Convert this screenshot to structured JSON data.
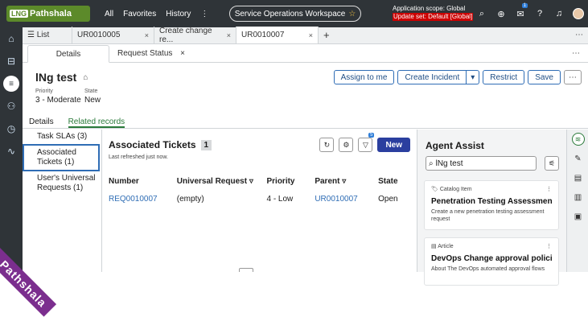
{
  "topbar": {
    "logo_abbr": "LNG",
    "logo_text": "Pathshala",
    "nav": [
      "All",
      "Favorites",
      "History",
      "⋮"
    ],
    "workspace": "Service Operations Workspace",
    "scope_line1": "Application scope: Global",
    "scope_line2": "Update set: Default [Global]",
    "chat_badge": "1"
  },
  "tabs": [
    {
      "label": "☰ List"
    },
    {
      "label": "UR0010005",
      "close": "×"
    },
    {
      "label": "Create change re...",
      "close": "×"
    },
    {
      "label": "UR0010007",
      "close": "×"
    }
  ],
  "subtabs": [
    {
      "label": "Details"
    },
    {
      "label": "Request Status",
      "close": "×"
    }
  ],
  "record": {
    "title": "lNg test",
    "priority_label": "Priority",
    "priority_value": "3 - Moderate",
    "state_label": "State",
    "state_value": "New",
    "buttons": [
      "Assign to me",
      "Create Incident",
      "Restrict",
      "Save"
    ]
  },
  "record_tabs": [
    "Details",
    "Related records"
  ],
  "related_nav": [
    "Task SLAs (3)",
    "Associated Tickets (1)",
    "User's Universal Requests (1)"
  ],
  "associated": {
    "title": "Associated Tickets",
    "count": "1",
    "refreshed": "Last refreshed just now.",
    "filter_badge": "5",
    "new_label": "New",
    "columns": [
      "Number",
      "Universal Request",
      "Priority",
      "Parent",
      "State"
    ],
    "rows": [
      [
        "REQ0010007",
        "(empty)",
        "4 - Low",
        "UR0010007",
        "Open"
      ]
    ]
  },
  "agent_assist": {
    "title": "Agent Assist",
    "search_value": "lNg test",
    "cards": [
      {
        "type": "Catalog Item",
        "title": "Penetration Testing Assessment Re...",
        "desc": "Create a new penetration testing assessment request"
      },
      {
        "type": "Article",
        "title": "DevOps Change approval policies ...",
        "desc": "About The DevOps automated approval flows"
      }
    ]
  },
  "banner": "LNG Pathshala"
}
